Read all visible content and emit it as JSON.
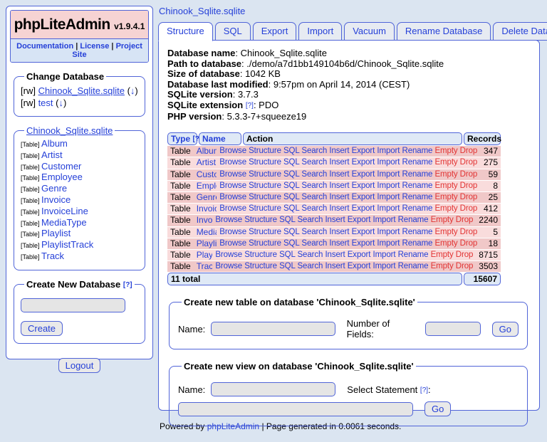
{
  "app": {
    "title": "phpLiteAdmin",
    "version": "v1.9.4.1",
    "nav_separator": "|",
    "nav_links": [
      "Documentation",
      "License",
      "Project Site"
    ]
  },
  "sidebar": {
    "change_database": {
      "legend": "Change Database",
      "download_open": "(",
      "download_arrow": "↓",
      "download_close": ")",
      "items": [
        {
          "prefix": "[rw]",
          "name": "Chinook_Sqlite.sqlite",
          "current": true
        },
        {
          "prefix": "[rw]",
          "name": "test",
          "current": false
        }
      ]
    },
    "current_database": {
      "legend": "Chinook_Sqlite.sqlite",
      "item_prefix": "[Table]",
      "tables": [
        "Album",
        "Artist",
        "Customer",
        "Employee",
        "Genre",
        "Invoice",
        "InvoiceLine",
        "MediaType",
        "Playlist",
        "PlaylistTrack",
        "Track"
      ]
    },
    "create_database": {
      "legend": "Create New Database",
      "help": "[?]",
      "input_value": "",
      "button": "Create"
    },
    "logout_button": "Logout"
  },
  "main": {
    "breadcrumb": "Chinook_Sqlite.sqlite",
    "tabs": [
      {
        "label": "Structure",
        "active": true,
        "danger": false
      },
      {
        "label": "SQL",
        "active": false,
        "danger": false
      },
      {
        "label": "Export",
        "active": false,
        "danger": false
      },
      {
        "label": "Import",
        "active": false,
        "danger": false
      },
      {
        "label": "Vacuum",
        "active": false,
        "danger": false
      },
      {
        "label": "Rename Database",
        "active": false,
        "danger": false
      },
      {
        "label": "Delete Database",
        "active": false,
        "danger": true
      }
    ],
    "info": [
      {
        "label": "Database name",
        "value": "Chinook_Sqlite.sqlite"
      },
      {
        "label": "Path to database",
        "value": "./demo/a7d1bb149104b6d/Chinook_Sqlite.sqlite"
      },
      {
        "label": "Size of database",
        "value": "1042 KB"
      },
      {
        "label": "Database last modified",
        "value": "9:57pm on April 14, 2014 (CEST)"
      },
      {
        "label": "SQLite version",
        "value": "3.7.3"
      },
      {
        "label": "SQLite extension",
        "help": "[?]",
        "value": "PDO"
      },
      {
        "label": "PHP version",
        "value": "5.3.3-7+squeeze19"
      }
    ],
    "tables_table": {
      "headers": {
        "type": "Type",
        "type_help": "[?]",
        "name": "Name",
        "action": "Action",
        "records": "Records"
      },
      "action_links": [
        "Browse",
        "Structure",
        "SQL",
        "Search",
        "Insert",
        "Export",
        "Import",
        "Rename"
      ],
      "danger_links": [
        "Empty",
        "Drop"
      ],
      "rows": [
        {
          "type": "Table",
          "name": "Album",
          "records": "347"
        },
        {
          "type": "Table",
          "name": "Artist",
          "records": "275"
        },
        {
          "type": "Table",
          "name": "Customer",
          "records": "59"
        },
        {
          "type": "Table",
          "name": "Employee",
          "records": "8"
        },
        {
          "type": "Table",
          "name": "Genre",
          "records": "25"
        },
        {
          "type": "Table",
          "name": "Invoice",
          "records": "412"
        },
        {
          "type": "Table",
          "name": "InvoiceLine",
          "records": "2240"
        },
        {
          "type": "Table",
          "name": "MediaType",
          "records": "5"
        },
        {
          "type": "Table",
          "name": "Playlist",
          "records": "18"
        },
        {
          "type": "Table",
          "name": "PlaylistTrack",
          "records": "8715"
        },
        {
          "type": "Table",
          "name": "Track",
          "records": "3503"
        }
      ],
      "total_label": "11 total",
      "total_records": "15607"
    },
    "create_table": {
      "legend": "Create new table on database 'Chinook_Sqlite.sqlite'",
      "name_label": "Name:",
      "name_value": "",
      "fields_label": "Number of Fields:",
      "fields_value": "",
      "go_button": "Go"
    },
    "create_view": {
      "legend": "Create new view on database 'Chinook_Sqlite.sqlite'",
      "name_label": "Name:",
      "name_value": "",
      "select_label": "Select Statement",
      "select_help": "[?]",
      "select_colon": ":",
      "select_value": "",
      "go_button": "Go"
    }
  },
  "footer": {
    "prefix": "Powered by",
    "link": "phpLiteAdmin",
    "suffix": "| Page generated in 0.0061 seconds."
  }
}
